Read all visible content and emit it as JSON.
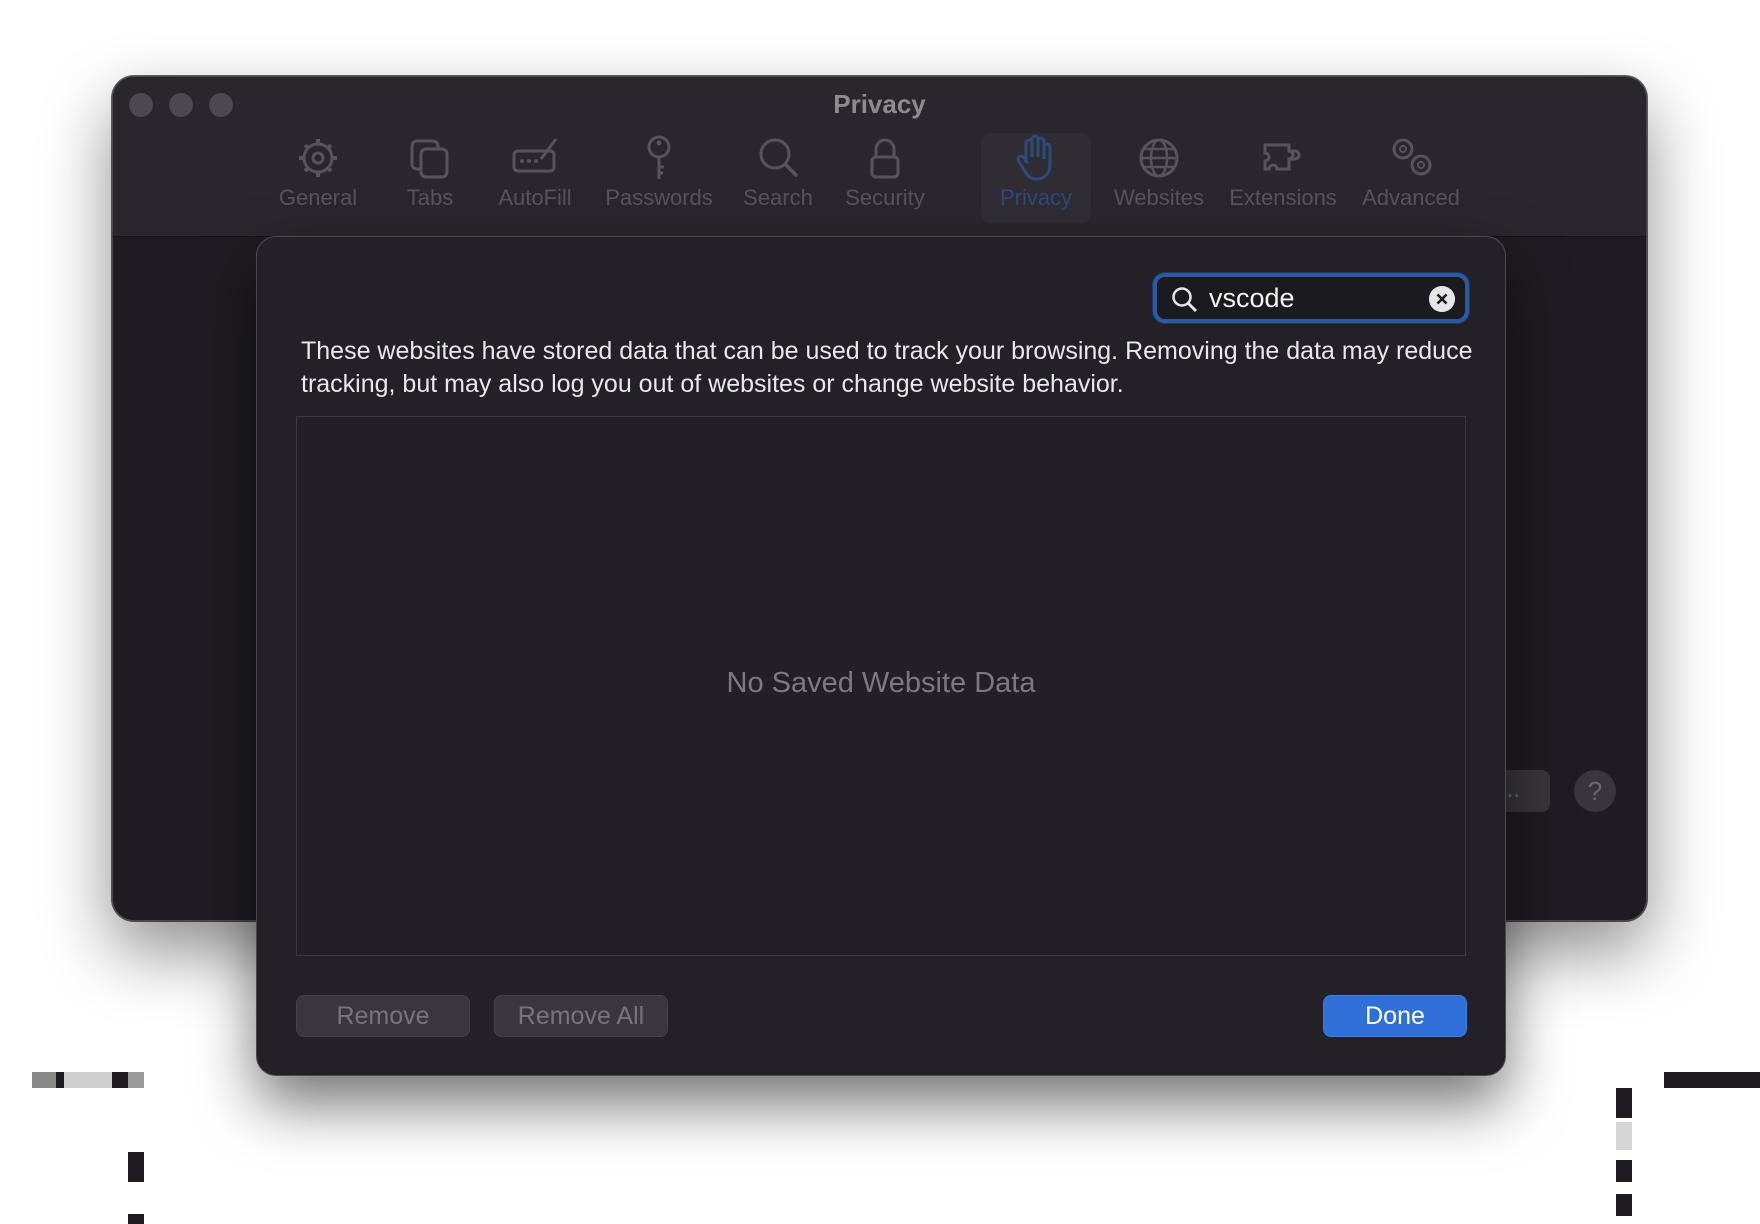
{
  "window": {
    "title": "Privacy",
    "toolbar": [
      {
        "label": "General",
        "icon": "gear-icon"
      },
      {
        "label": "Tabs",
        "icon": "tabs-icon"
      },
      {
        "label": "AutoFill",
        "icon": "pencil-field-icon"
      },
      {
        "label": "Passwords",
        "icon": "key-icon"
      },
      {
        "label": "Search",
        "icon": "search-icon"
      },
      {
        "label": "Security",
        "icon": "lock-icon"
      },
      {
        "label": "Privacy",
        "icon": "hand-icon",
        "active": true
      },
      {
        "label": "Websites",
        "icon": "globe-icon"
      },
      {
        "label": "Extensions",
        "icon": "puzzle-icon"
      },
      {
        "label": "Advanced",
        "icon": "gears-icon"
      }
    ],
    "details_button": "...",
    "help_button": "?"
  },
  "sheet": {
    "search": {
      "value": "vscode"
    },
    "description": "These websites have stored data that can be used to track your browsing. Removing the data may reduce tracking, but may also log you out of websites or change website behavior.",
    "empty_text": "No Saved Website Data",
    "buttons": {
      "remove": "Remove",
      "remove_all": "Remove All",
      "done": "Done"
    }
  },
  "colors": {
    "accent": "#2f6fd8",
    "focus_ring": "#2c5aa0",
    "sheet_bg": "#232127",
    "window_bg": "#1e1c22"
  }
}
